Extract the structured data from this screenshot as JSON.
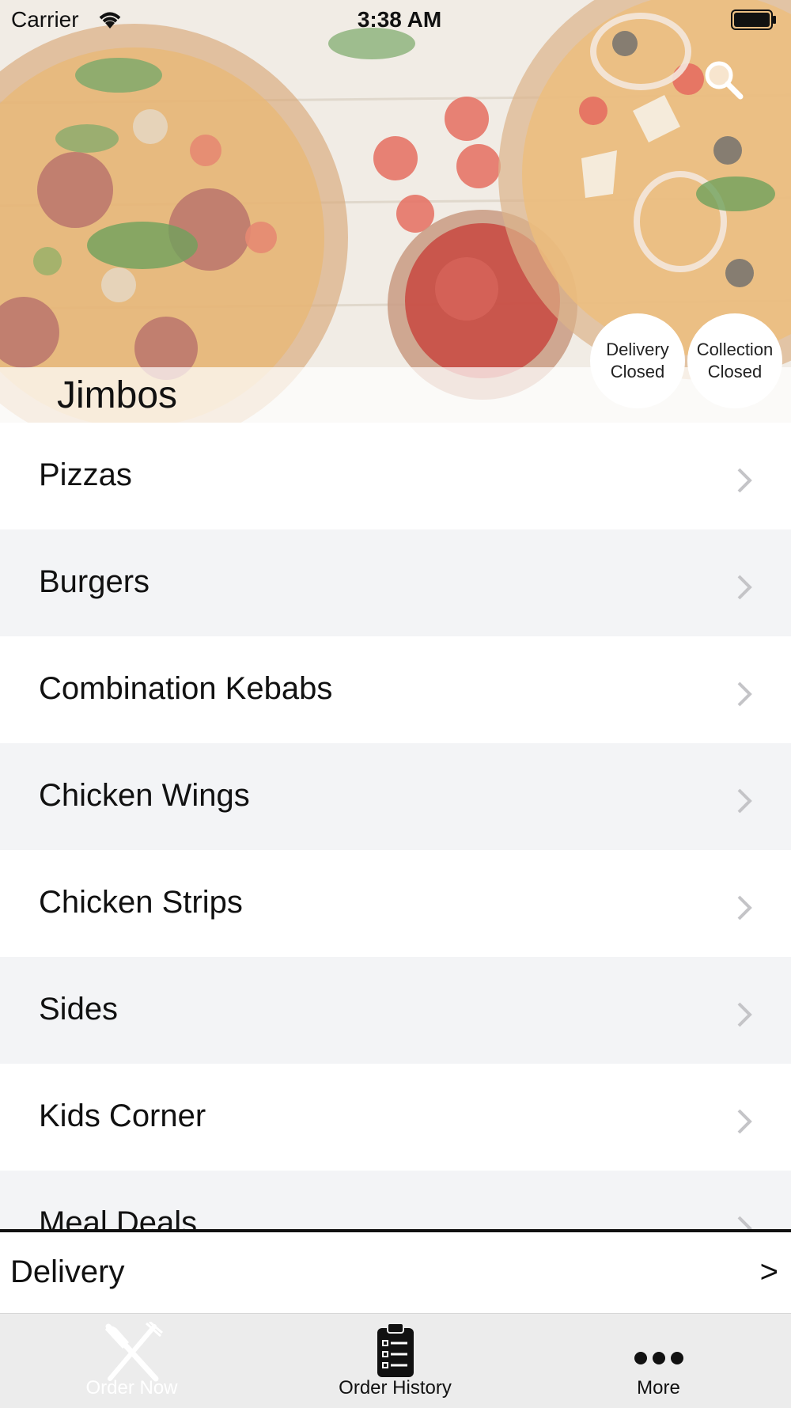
{
  "status_bar": {
    "carrier": "Carrier",
    "time": "3:38 AM"
  },
  "restaurant": {
    "name": "Jimbos"
  },
  "badges": {
    "delivery": {
      "line1": "Delivery",
      "line2": "Closed"
    },
    "collection": {
      "line1": "Collection",
      "line2": "Closed"
    }
  },
  "menu": {
    "items": [
      {
        "label": "Pizzas"
      },
      {
        "label": "Burgers"
      },
      {
        "label": "Combination Kebabs"
      },
      {
        "label": "Chicken Wings"
      },
      {
        "label": "Chicken Strips"
      },
      {
        "label": "Sides"
      },
      {
        "label": "Kids Corner"
      },
      {
        "label": "Meal Deals"
      }
    ]
  },
  "order_mode": {
    "label": "Delivery",
    "arrow": ">"
  },
  "tabbar": {
    "tabs": [
      {
        "label": "Order Now",
        "icon": "fork-knife-icon"
      },
      {
        "label": "Order History",
        "icon": "clipboard-list-icon"
      },
      {
        "label": "More",
        "icon": "more-dots-icon"
      }
    ]
  }
}
